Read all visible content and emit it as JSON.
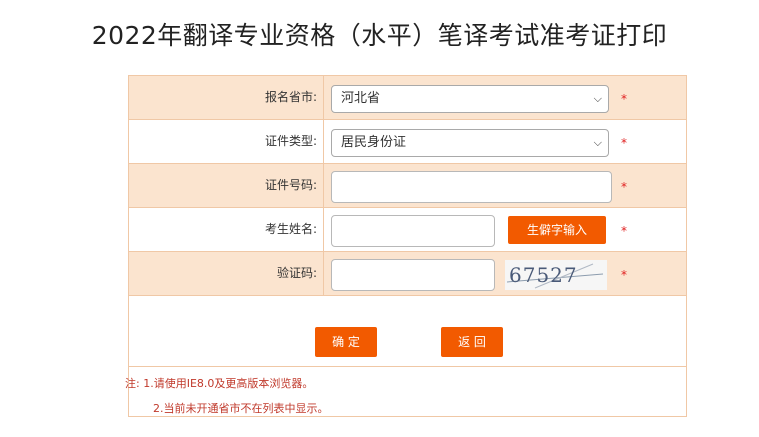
{
  "page": {
    "title": "2022年翻译专业资格（水平）笔译考试准考证打印"
  },
  "form": {
    "province": {
      "label": "报名省市:",
      "selected": "河北省"
    },
    "id_type": {
      "label": "证件类型:",
      "selected": "居民身份证"
    },
    "id_number": {
      "label": "证件号码:",
      "value": ""
    },
    "name": {
      "label": "考生姓名:",
      "value": "",
      "rare_char_button": "生僻字输入"
    },
    "captcha": {
      "label": "验证码:",
      "value": "",
      "code": "67527"
    },
    "required_mark": "*"
  },
  "actions": {
    "confirm_label": "确 定",
    "back_label": "返 回"
  },
  "notes": {
    "line1": "注: 1.请使用IE8.0及更高版本浏览器。",
    "line2": "2.当前未开通省市不在列表中显示。"
  },
  "colors": {
    "accent": "#f25a00",
    "row_shade": "#fbe4cf",
    "border": "#f0c8a6",
    "required": "#e02020",
    "note_text": "#c0392b"
  }
}
